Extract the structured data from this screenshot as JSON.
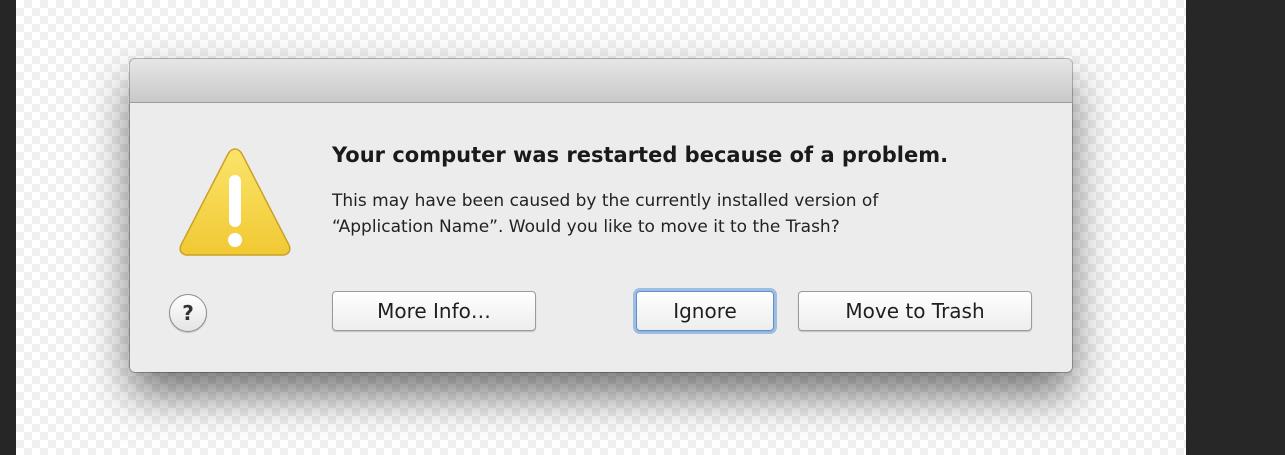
{
  "dialog": {
    "icon": "warning-triangle-icon",
    "headline": "Your computer was restarted because of a problem.",
    "message_line1": "This may have been caused by the currently installed version of",
    "message_line2": "“Application Name”. Would you like to move it to the Trash?",
    "help_glyph": "?",
    "buttons": {
      "more_info": "More Info…",
      "ignore": "Ignore",
      "move_to_trash": "Move to Trash"
    },
    "default_button": "ignore",
    "colors": {
      "warning_fill": "#f5d547",
      "focus_ring": "#6096dc"
    }
  }
}
